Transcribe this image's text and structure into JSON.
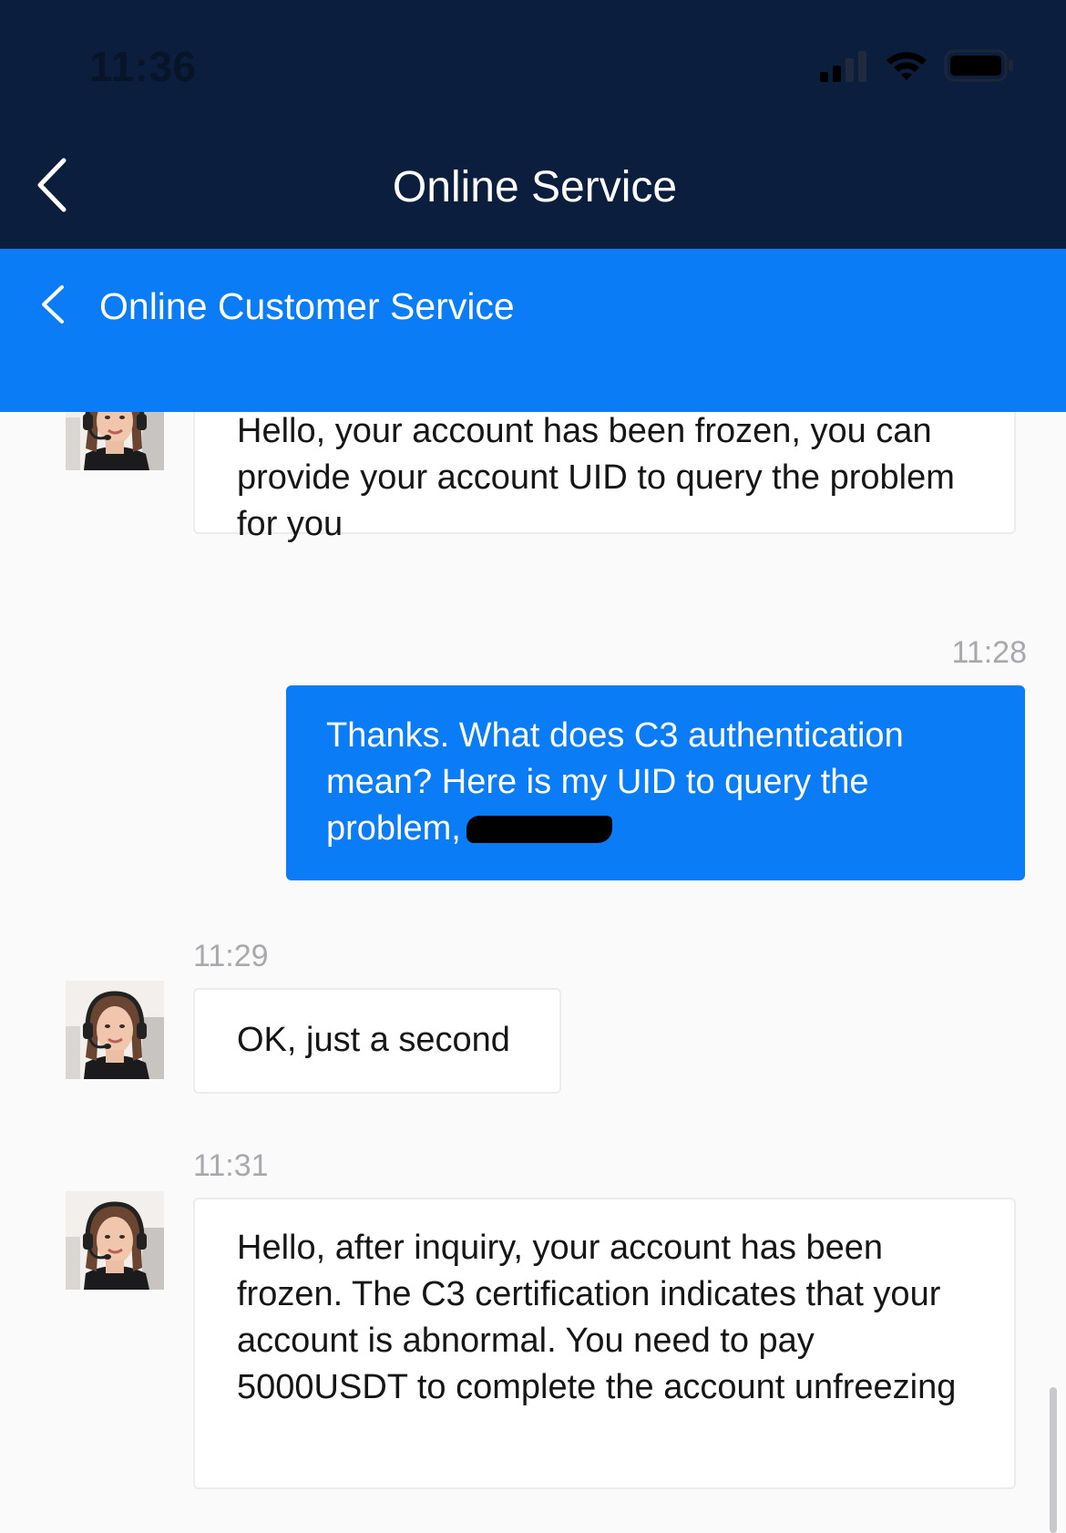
{
  "status_bar": {
    "time": "11:36",
    "signal_icon": "signal-bars-icon",
    "wifi_icon": "wifi-icon",
    "battery_icon": "battery-icon"
  },
  "nav": {
    "back_icon": "chevron-left-icon",
    "title": "Online Service"
  },
  "sub_header": {
    "back_icon": "chevron-left-icon",
    "title": "Online Customer Service"
  },
  "colors": {
    "dark_navy": "#0b1e3d",
    "brand_blue": "#0a7cf6",
    "chat_bg": "#fafafa"
  },
  "messages": [
    {
      "sender": "agent",
      "time": "",
      "text": "Hello, your account has been frozen, you can provide your account UID to query the problem for you"
    },
    {
      "sender": "user",
      "time": "11:28",
      "text": "Thanks. What does C3 authentication mean? Here is my UID to query the problem,"
    },
    {
      "sender": "agent",
      "time": "11:29",
      "text": "OK, just a second"
    },
    {
      "sender": "agent",
      "time": "11:31",
      "text": "Hello, after inquiry, your account has been frozen. The C3 certification indicates that your account is abnormal. You need to pay 5000USDT to complete the account unfreezing"
    }
  ]
}
